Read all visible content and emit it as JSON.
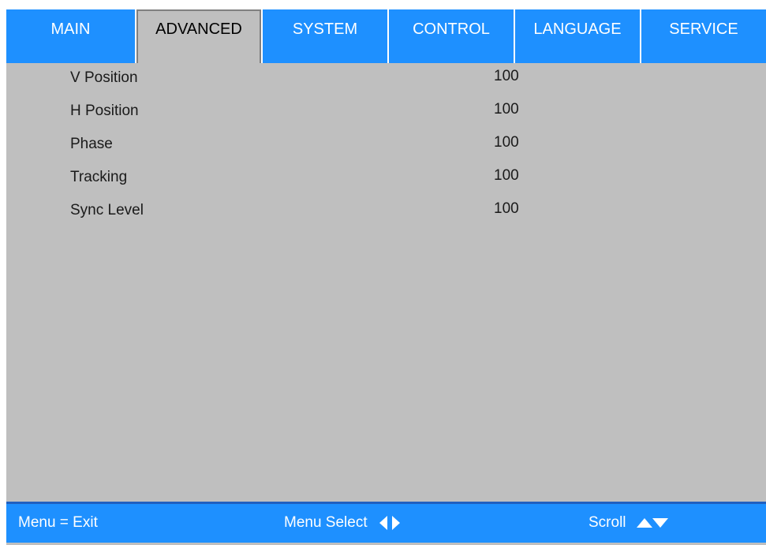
{
  "tabs": [
    {
      "label": "MAIN",
      "active": false
    },
    {
      "label": "ADVANCED",
      "active": true
    },
    {
      "label": "SYSTEM",
      "active": false
    },
    {
      "label": "CONTROL",
      "active": false
    },
    {
      "label": "LANGUAGE",
      "active": false
    },
    {
      "label": "SERVICE",
      "active": false
    }
  ],
  "menu_items": [
    {
      "label": "V Position",
      "value": "100"
    },
    {
      "label": "H Position",
      "value": "100"
    },
    {
      "label": "Phase",
      "value": "100"
    },
    {
      "label": "Tracking",
      "value": "100"
    },
    {
      "label": "Sync Level",
      "value": "100"
    }
  ],
  "footer": {
    "exit_hint": "Menu = Exit",
    "select_hint": "Menu Select",
    "select_icon": "left-right-arrows-icon",
    "scroll_hint": "Scroll",
    "scroll_icon": "up-down-arrows-icon"
  },
  "colors": {
    "tab_blue": "#1e90ff",
    "panel_gray": "#bfbfbf",
    "footer_blue": "#1e90ff"
  }
}
